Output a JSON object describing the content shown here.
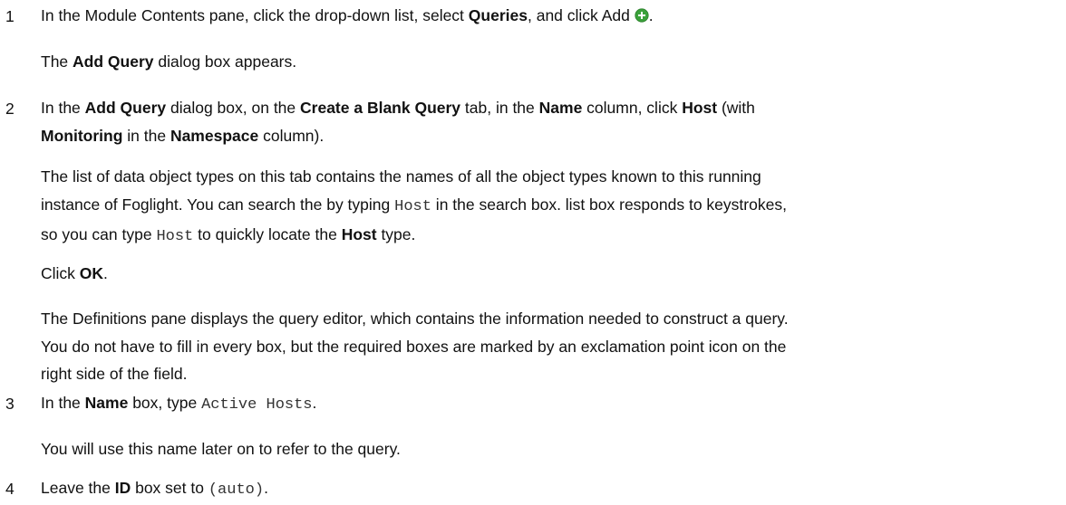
{
  "steps": [
    {
      "number": "1",
      "line_a": "In the Module Contents pane, click the drop-down list, select ",
      "bold_a": "Queries",
      "line_b": ", and click Add ",
      "line_c": ".",
      "icon": "add-green-circle-icon"
    },
    {
      "bold_a": "Add Query",
      "rest": " dialog box appears.",
      "prefix": "The "
    },
    {
      "number": "2",
      "t1": "In the ",
      "b1": "Add Query",
      "t2": " dialog box, on the ",
      "b2": "Create a Blank Query",
      "t3": " tab, in the ",
      "b3": "Name",
      "t4": " column, click ",
      "b4": "Host",
      "t5": " (with",
      "b5": "Monitoring",
      "t6": " in the ",
      "b6": "Namespace",
      "t7": " column)."
    },
    {
      "t1": "The list of data object types on this tab contains the names of all the object types known to this running",
      "t2": "instance of Foglight. You can search the by typing ",
      "c1": "Host",
      "t3": " in the search box. list box responds to keystrokes,",
      "t4": "so you can type ",
      "c2": "Host",
      "t5": " to quickly locate the ",
      "b1": "Host",
      "t6": " type."
    },
    {
      "t1": "Click ",
      "b1": "OK",
      "t2": "."
    },
    {
      "t1": "The Definitions pane displays the query editor, which contains the information needed to construct a query.",
      "t2": "You do not have to fill in every box, but the required boxes are marked by an exclamation point icon on the",
      "t3": "right side of the field."
    },
    {
      "number": "3",
      "t1": "In the ",
      "b1": "Name",
      "t2": " box, type ",
      "c1": "Active Hosts",
      "t3": "."
    },
    {
      "t1": "You will use this name later on to refer to the query."
    },
    {
      "number": "4",
      "t1": "Leave the ",
      "b1": "ID",
      "t2": " box set to ",
      "c1": "(auto)",
      "t3": "."
    }
  ],
  "colors": {
    "icon_green": "#3aa13a",
    "text": "#111111"
  }
}
